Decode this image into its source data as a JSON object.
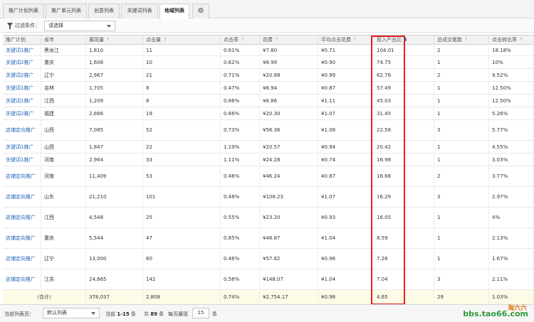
{
  "tabs": [
    {
      "label": "推广计划列表"
    },
    {
      "label": "推广单元列表"
    },
    {
      "label": "创意列表"
    },
    {
      "label": "关键词列表"
    },
    {
      "label": "地域列表"
    }
  ],
  "filter": {
    "label": "过滤条件：",
    "selected": "请选择"
  },
  "columns": [
    "推广计划",
    "省市",
    "展现量",
    "点击量",
    "点击率",
    "花费",
    "平均点击花费",
    "投入产出比",
    "总成交笔数",
    "点击转化率"
  ],
  "rows": [
    {
      "plan": "关键词1推广",
      "region": "黑龙江",
      "impressions": "1,810",
      "clicks": "11",
      "ctr": "0.61%",
      "cost": "¥7.80",
      "cpc": "¥0.71",
      "roi": "104.01",
      "orders": "2",
      "cvr": "18.18%"
    },
    {
      "plan": "关键词2推广",
      "region": "重庆",
      "impressions": "1,608",
      "clicks": "10",
      "ctr": "0.62%",
      "cost": "¥8.99",
      "cpc": "¥0.90",
      "roi": "74.75",
      "orders": "1",
      "cvr": "10%"
    },
    {
      "plan": "关键词2推广",
      "region": "辽宁",
      "impressions": "2,967",
      "clicks": "21",
      "ctr": "0.71%",
      "cost": "¥20.88",
      "cpc": "¥0.99",
      "roi": "62.76",
      "orders": "2",
      "cvr": "9.52%"
    },
    {
      "plan": "关键词1推广",
      "region": "吉林",
      "impressions": "1,705",
      "clicks": "8",
      "ctr": "0.47%",
      "cost": "¥6.94",
      "cpc": "¥0.87",
      "roi": "57.49",
      "orders": "1",
      "cvr": "12.50%"
    },
    {
      "plan": "关键词1推广",
      "region": "江西",
      "impressions": "1,209",
      "clicks": "8",
      "ctr": "0.66%",
      "cost": "¥8.86",
      "cpc": "¥1.11",
      "roi": "45.03",
      "orders": "1",
      "cvr": "12.50%"
    },
    {
      "plan": "关键词2推广",
      "region": "福建",
      "impressions": "2,866",
      "clicks": "19",
      "ctr": "0.66%",
      "cost": "¥20.30",
      "cpc": "¥1.07",
      "roi": "31.45",
      "orders": "1",
      "cvr": "5.26%"
    },
    {
      "plan": "店铺定向推广",
      "region": "山西",
      "impressions": "7,085",
      "clicks": "52",
      "ctr": "0.73%",
      "cost": "¥56.36",
      "cpc": "¥1.08",
      "roi": "22.58",
      "orders": "3",
      "cvr": "5.77%"
    },
    {
      "plan": "关键词1推广",
      "region": "山西",
      "impressions": "1,847",
      "clicks": "22",
      "ctr": "1.19%",
      "cost": "¥20.57",
      "cpc": "¥0.94",
      "roi": "20.42",
      "orders": "1",
      "cvr": "4.55%"
    },
    {
      "plan": "关键词1推广",
      "region": "河南",
      "impressions": "2,964",
      "clicks": "33",
      "ctr": "1.11%",
      "cost": "¥24.28",
      "cpc": "¥0.74",
      "roi": "16.98",
      "orders": "1",
      "cvr": "3.03%"
    },
    {
      "plan": "店铺定向推广",
      "region": "河南",
      "impressions": "11,409",
      "clicks": "53",
      "ctr": "0.46%",
      "cost": "¥46.24",
      "cpc": "¥0.87",
      "roi": "16.68",
      "orders": "2",
      "cvr": "3.77%"
    },
    {
      "plan": "店铺定向推广",
      "region": "山东",
      "impressions": "21,210",
      "clicks": "101",
      "ctr": "0.48%",
      "cost": "¥108.23",
      "cpc": "¥1.07",
      "roi": "16.29",
      "orders": "3",
      "cvr": "2.97%"
    },
    {
      "plan": "店铺定向推广",
      "region": "江西",
      "impressions": "4,548",
      "clicks": "25",
      "ctr": "0.55%",
      "cost": "¥23.20",
      "cpc": "¥0.93",
      "roi": "16.05",
      "orders": "1",
      "cvr": "4%"
    },
    {
      "plan": "店铺定向推广",
      "region": "重庆",
      "impressions": "5,544",
      "clicks": "47",
      "ctr": "0.85%",
      "cost": "¥48.87",
      "cpc": "¥1.04",
      "roi": "8.59",
      "orders": "1",
      "cvr": "2.13%"
    },
    {
      "plan": "店铺定向推广",
      "region": "辽宁",
      "impressions": "13,000",
      "clicks": "60",
      "ctr": "0.46%",
      "cost": "¥57.82",
      "cpc": "¥0.96",
      "roi": "7.26",
      "orders": "1",
      "cvr": "1.67%"
    },
    {
      "plan": "店铺定向推广",
      "region": "江苏",
      "impressions": "24,665",
      "clicks": "142",
      "ctr": "0.58%",
      "cost": "¥148.07",
      "cpc": "¥1.04",
      "roi": "7.04",
      "orders": "3",
      "cvr": "2.11%"
    }
  ],
  "total": {
    "label": "（合计）",
    "impressions": "378,037",
    "clicks": "2,808",
    "ctr": "0.74%",
    "cost": "¥2,754.17",
    "cpc": "¥0.98",
    "roi": "4.65",
    "orders": "29",
    "cvr": "1.03%"
  },
  "footer": {
    "current_list_label": "当前列表页：",
    "list_select": "默认列表",
    "range_prefix": "当前",
    "range": "1-15",
    "range_suffix": "条",
    "total_prefix": "共",
    "total_count": "89",
    "total_suffix": "条",
    "pagesize_label": "每页展现",
    "pagesize": "15",
    "pagesize_suffix": "条"
  },
  "watermark": {
    "text": "bbs.tao66.com",
    "logo_text": "淘六六"
  },
  "colors": {
    "link": "#2266bb",
    "highlight_box": "#e02020",
    "total_row": "#fdfbe5",
    "watermark": "#2f9a3c"
  },
  "icons": {
    "settings": "gear-icon",
    "filter": "filter-icon",
    "sort": "sort-arrow-icon",
    "sort_active": "sort-down-icon"
  }
}
